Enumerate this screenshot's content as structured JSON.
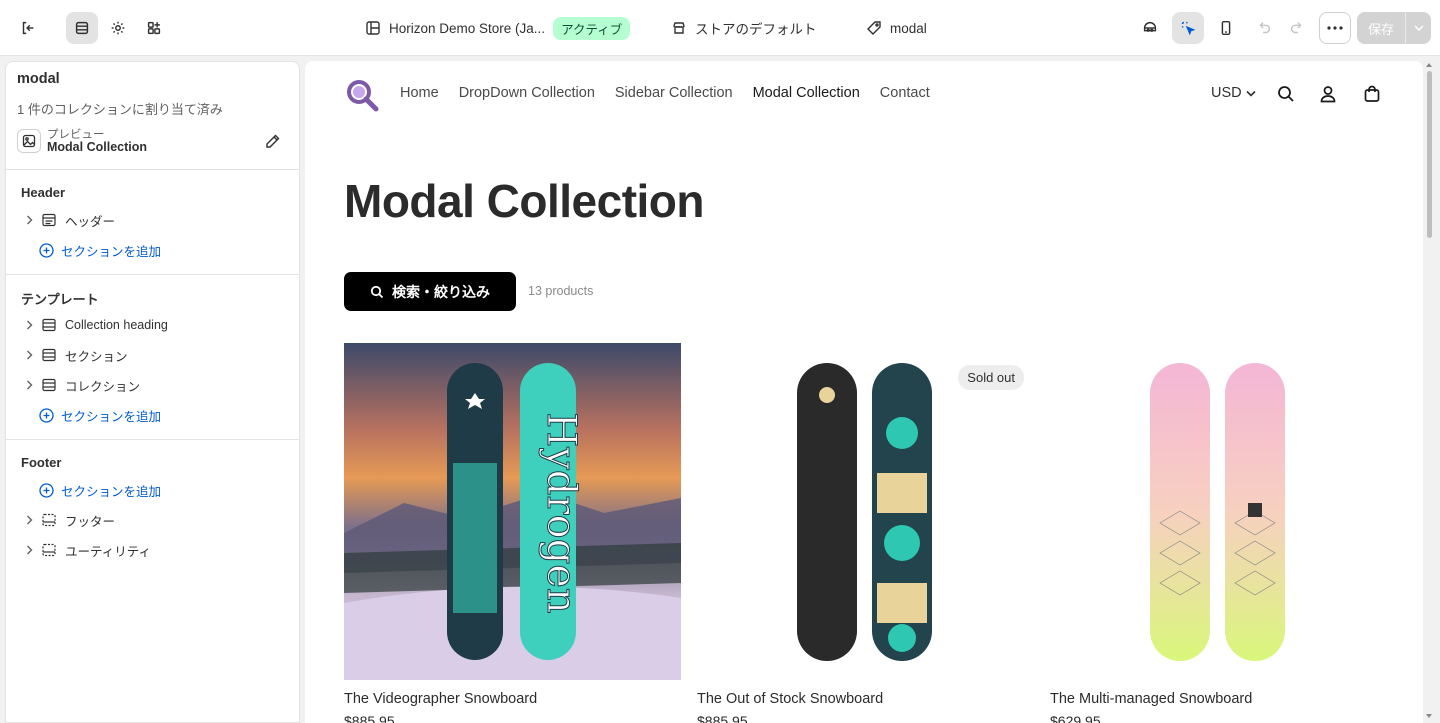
{
  "topbar": {
    "store_name": "Horizon Demo Store (Ja...",
    "status_badge": "アクティブ",
    "template_name": "ストアのデフォルト",
    "page_name": "modal",
    "save_label": "保存"
  },
  "sidebar": {
    "title": "modal",
    "subtitle": "1 件のコレクションに割り当て済み",
    "preview_label": "プレビュー",
    "preview_value": "Modal Collection",
    "header_group": {
      "title": "Header",
      "items": [
        "ヘッダー"
      ],
      "add_label": "セクションを追加"
    },
    "template_group": {
      "title": "テンプレート",
      "items": [
        "Collection heading",
        "セクション",
        "コレクション"
      ],
      "add_label": "セクションを追加"
    },
    "footer_group": {
      "title": "Footer",
      "add_label": "セクションを追加",
      "items": [
        "フッター",
        "ユーティリティ"
      ]
    }
  },
  "storefront": {
    "nav": [
      "Home",
      "DropDown Collection",
      "Sidebar Collection",
      "Modal Collection",
      "Contact"
    ],
    "currency": "USD",
    "page_title": "Modal Collection",
    "filter_button": "検索・絞り込み",
    "product_count": "13 products",
    "products": [
      {
        "name": "The Videographer Snowboard",
        "price": "$885.95",
        "badge": ""
      },
      {
        "name": "The Out of Stock Snowboard",
        "price": "$885.95",
        "badge": "Sold out"
      },
      {
        "name": "The Multi-managed Snowboard",
        "price": "$629.95",
        "badge": ""
      }
    ]
  },
  "colors": {
    "accent_blue": "#005bd3",
    "active_badge_bg": "#b4fed2",
    "logo_purple": "#7d5aa8",
    "board_teal": "#3fcfbd"
  }
}
